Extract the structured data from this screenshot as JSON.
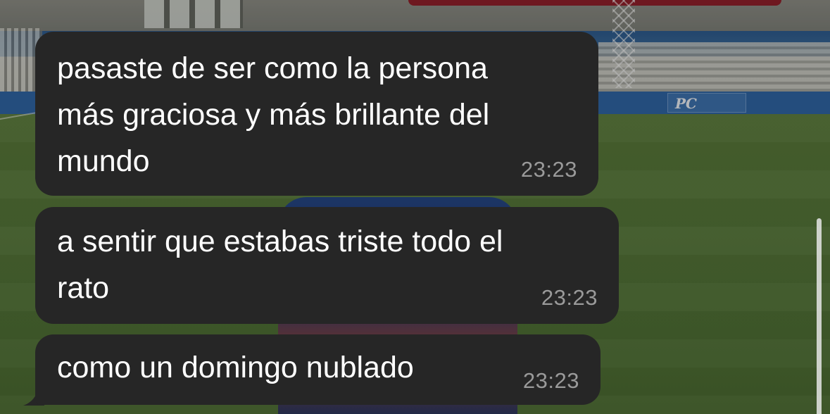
{
  "chat": {
    "messages": [
      {
        "text": "pasaste de ser como la persona\nmás graciosa y más brillante del\nmundo",
        "time": "23:23"
      },
      {
        "text": "a sentir que estabas triste todo el\nrato",
        "time": "23:23"
      },
      {
        "text": "como un domingo nublado",
        "time": "23:23"
      }
    ]
  },
  "background": {
    "ad_board_text": "PC"
  },
  "colors": {
    "bubble": "#262626",
    "text": "#ffffff",
    "timestamp": "#9a9a9a",
    "scrollbar": "#e6e6e6"
  }
}
